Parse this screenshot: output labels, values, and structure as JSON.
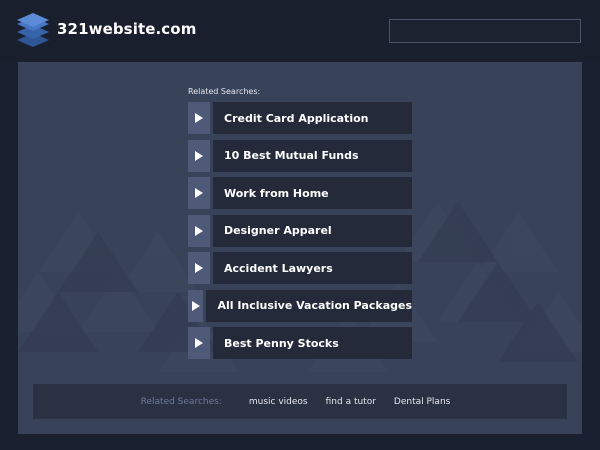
{
  "header": {
    "site_name": "321website.com",
    "logo_icon": "stacked-layers-icon",
    "search": {
      "value": ""
    }
  },
  "main": {
    "related_heading": "Related Searches:",
    "results": [
      {
        "label": "Credit Card Application"
      },
      {
        "label": "10 Best Mutual Funds"
      },
      {
        "label": "Work from Home"
      },
      {
        "label": "Designer Apparel"
      },
      {
        "label": "Accident Lawyers"
      },
      {
        "label": "All Inclusive Vacation Packages"
      },
      {
        "label": "Best Penny Stocks"
      }
    ],
    "arrow_icon": "play-arrow-icon"
  },
  "footer": {
    "label": "Related Searches:",
    "links": [
      "music videos",
      "find a tutor",
      "Dental Plans"
    ]
  },
  "colors": {
    "page_bg": "#1b2030",
    "main_bg": "#384258",
    "item_bg": "#242a39",
    "arrow_bg": "#4f5a78",
    "logo_blue": "#3d6db8",
    "text": "#ffffff"
  }
}
